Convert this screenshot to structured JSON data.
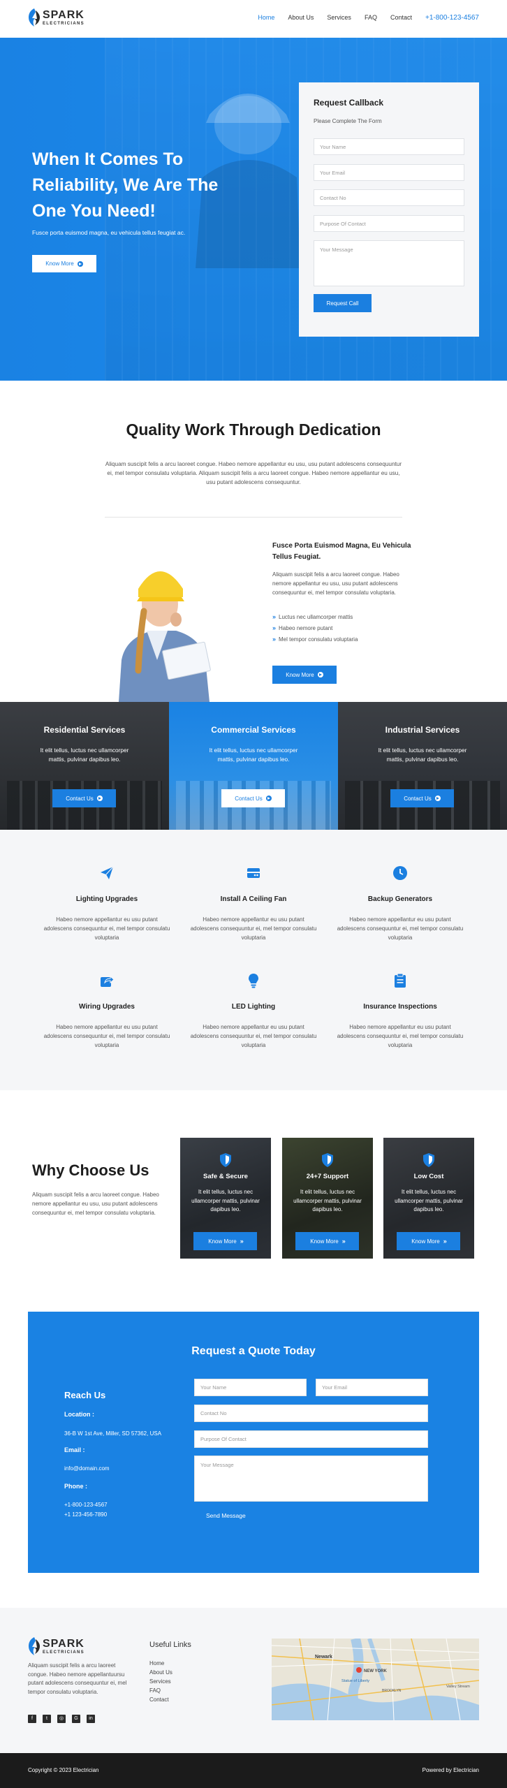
{
  "brand": {
    "name": "SPARK",
    "tagline": "ELECTRICIANS",
    "accent": "#1b7fe0"
  },
  "nav": {
    "items": [
      "Home",
      "About Us",
      "Services",
      "FAQ",
      "Contact"
    ],
    "phone": "+1-800-123-4567"
  },
  "hero": {
    "headline": "When It Comes To Reliability, We Are The One You Need!",
    "subtext": "Fusce porta euismod magna, eu vehicula tellus feugiat ac.",
    "button": "Know More"
  },
  "callback": {
    "title": "Request Callback",
    "subtitle": "Please Complete The Form",
    "placeholders": {
      "name": "Your Name",
      "email": "Your Email",
      "contact": "Contact No",
      "purpose": "Purpose Of Contact",
      "message": "Your Message"
    },
    "button": "Request Call"
  },
  "quality": {
    "title": "Quality Work Through Dedication",
    "text": "Aliquam suscipit felis a arcu laoreet congue. Habeo nemore appellantur eu usu, usu putant adolescens consequuntur ei, mel tempor consulatu voluptaria. Aliquam suscipit felis a arcu laoreet congue. Habeo nemore appellantur eu usu, usu putant adolescens consequuntur.",
    "feature_title": "Fusce Porta Euismod Magna, Eu Vehicula Tellus Feugiat.",
    "feature_text": "Aliquam suscipit felis a arcu laoreet congue. Habeo nemore appellantur eu usu, usu putant adolescens consequuntur ei, mel tempor consulatu voluptaria.",
    "checks": [
      "Luctus nec ullamcorper mattis",
      "Habeo nemore putant",
      "Mel tempor consulatu voluptaria"
    ],
    "button": "Know More"
  },
  "services": [
    {
      "title": "Residential Services",
      "text": "It elit tellus, luctus nec ullamcorper mattis, pulvinar dapibus leo.",
      "button": "Contact Us"
    },
    {
      "title": "Commercial Services",
      "text": "It elit tellus, luctus nec ullamcorper mattis, pulvinar dapibus leo.",
      "button": "Contact Us"
    },
    {
      "title": "Industrial Services",
      "text": "It elit tellus, luctus nec ullamcorper mattis, pulvinar dapibus leo.",
      "button": "Contact Us"
    }
  ],
  "features": [
    {
      "icon": "paper-plane-icon",
      "title": "Lighting Upgrades",
      "text": "Habeo nemore appellantur eu usu putant adolescens consequuntur ei, mel tempor consulatu voluptaria"
    },
    {
      "icon": "fan-icon",
      "title": "Install A Ceiling Fan",
      "text": "Habeo nemore appellantur eu usu putant adolescens consequuntur ei, mel tempor consulatu voluptaria"
    },
    {
      "icon": "clock-icon",
      "title": "Backup Generators",
      "text": "Habeo nemore appellantur eu usu putant adolescens consequuntur ei, mel tempor consulatu voluptaria"
    },
    {
      "icon": "share-icon",
      "title": "Wiring Upgrades",
      "text": "Habeo nemore appellantur eu usu putant adolescens consequuntur ei, mel tempor consulatu voluptaria"
    },
    {
      "icon": "lightbulb-icon",
      "title": "LED Lighting",
      "text": "Habeo nemore appellantur eu usu putant adolescens consequuntur ei, mel tempor consulatu voluptaria"
    },
    {
      "icon": "clipboard-icon",
      "title": "Insurance Inspections",
      "text": "Habeo nemore appellantur eu usu putant adolescens consequuntur ei, mel tempor consulatu voluptaria"
    }
  ],
  "why": {
    "title": "Why Choose Us",
    "text": "Aliquam suscipit felis a arcu laoreet congue. Habeo nemore appellantur eu usu, usu putant adolescens consequuntur ei, mel tempor consulatu voluptaria.",
    "cards": [
      {
        "title": "Safe & Secure",
        "text": "It elit tellus, luctus nec ullamcorper mattis, pulvinar dapibus leo.",
        "button": "Know More"
      },
      {
        "title": "24+7 Support",
        "text": "It elit tellus, luctus nec ullamcorper mattis, pulvinar dapibus leo.",
        "button": "Know More"
      },
      {
        "title": "Low Cost",
        "text": "It elit tellus, luctus nec ullamcorper mattis, pulvinar dapibus leo.",
        "button": "Know More"
      }
    ]
  },
  "quote": {
    "title": "Request a Quote Today",
    "reach": "Reach Us",
    "location_label": "Location :",
    "location": "36-B W 1st Ave, Miller, SD 57362, USA",
    "email_label": "Email :",
    "email": "info@domain.com",
    "phone_label": "Phone :",
    "phone1": "+1-800-123-4567",
    "phone2": "+1 123-456-7890",
    "placeholders": {
      "name": "Your Name",
      "email": "Your Email",
      "contact": "Contact No",
      "purpose": "Purpose Of Contact",
      "message": "Your Message"
    },
    "button": "Send Message"
  },
  "footer": {
    "about": "Aliquam suscipit felis a arcu laoreet congue. Habeo nemore appellantuursu putant adolescens consequuntur ei, mel tempor consulatu voluptaria.",
    "links_title": "Useful Links",
    "links": [
      "Home",
      "About Us",
      "Services",
      "FAQ",
      "Contact"
    ],
    "map_labels": [
      "Newark",
      "NEW YORK",
      "Statue of Liberty",
      "BROOKLYN",
      "Valley Stream"
    ],
    "copyright": "Copyright © 2023 Electrician",
    "powered": "Powered by Electrician"
  }
}
